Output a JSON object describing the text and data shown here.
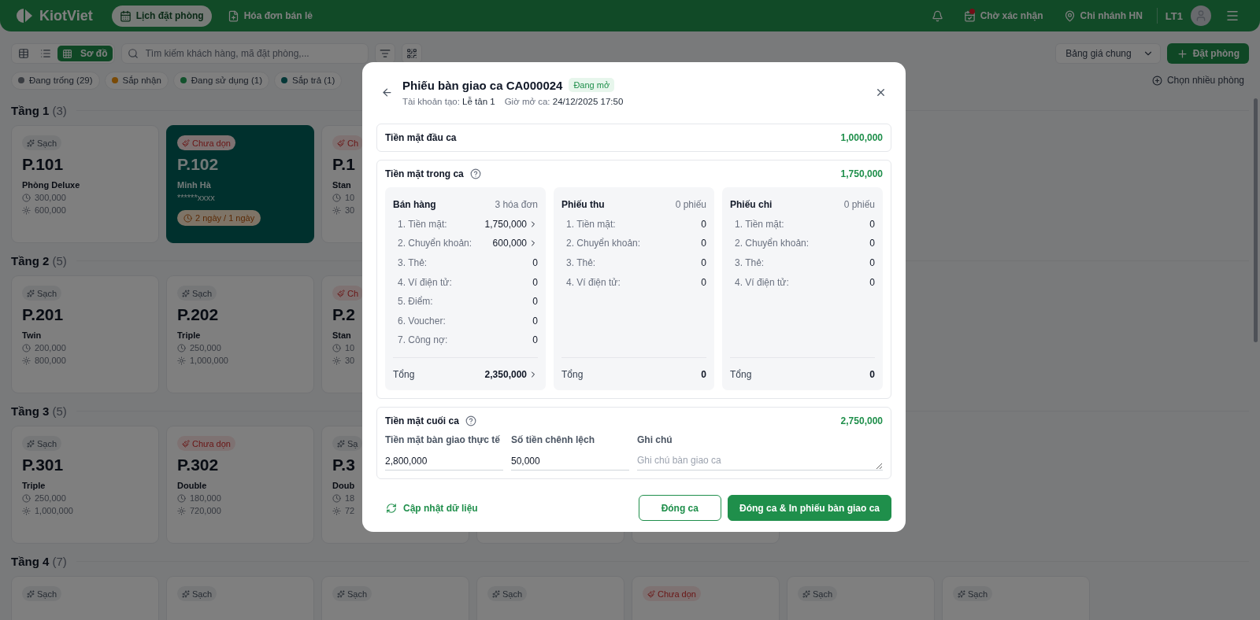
{
  "header": {
    "logo": "KiotViet",
    "tabs": [
      {
        "label": "Lịch đặt phòng",
        "kind": "calendar",
        "selected": true
      },
      {
        "label": "Hóa đơn bán lẻ",
        "kind": "invoice",
        "selected": false
      }
    ],
    "pending": "Chờ xác nhận",
    "pending_alert": true,
    "branch": "Chi nhánh HN",
    "user": "LT1"
  },
  "toolbar": {
    "views": [
      {
        "kind": "table",
        "selected": false
      },
      {
        "kind": "list",
        "selected": false
      },
      {
        "kind": "grid",
        "label": "Sơ đồ",
        "selected": true
      }
    ],
    "search": {
      "placeholder": "Tìm kiếm khách hàng, mã đặt phòng,..."
    },
    "price_list": "Bảng giá chung",
    "book_button": "Đặt phòng"
  },
  "status_filters": [
    {
      "label": "Đang trống (29)",
      "color": "#3a3d42"
    },
    {
      "label": "Sắp nhận",
      "color": "#7a4a06"
    },
    {
      "label": "Đang sử dụng (1)",
      "color": "#13522d"
    },
    {
      "label": "Sắp trả (1)",
      "color": "#053838"
    }
  ],
  "select_multiple": "Chọn nhiều phòng",
  "floors": [
    {
      "name": "Tầng 1",
      "count": "(3)",
      "rooms": [
        {
          "kind": "vacant",
          "status": {
            "kind": "clean",
            "label": "Sạch"
          },
          "name": "P.101",
          "type": "Phòng Deluxe",
          "hourly": "300,000",
          "daily": "600,000"
        },
        {
          "kind": "occupied",
          "status": {
            "kind": "dirty",
            "label": "Chưa dọn"
          },
          "name": "P.102",
          "guest": "Minh Hà",
          "phone": "******xxxx",
          "duration": "2 ngày / 1 ngày"
        },
        {
          "kind": "vacant",
          "status": {
            "kind": "dirty",
            "label": "Ch"
          },
          "name": "P.1",
          "type": "Stan",
          "hourly": "10",
          "daily": "30"
        }
      ]
    },
    {
      "name": "Tầng 2",
      "count": "(5)",
      "rooms": [
        {
          "kind": "vacant",
          "status": {
            "kind": "clean",
            "label": "Sạch"
          },
          "name": "P.201",
          "type": "Twin",
          "hourly": "200,000",
          "daily": "800,000"
        },
        {
          "kind": "vacant",
          "status": {
            "kind": "clean",
            "label": "Sạch"
          },
          "name": "P.202",
          "type": "Triple",
          "hourly": "250,000",
          "daily": "1,000,000"
        },
        {
          "kind": "vacant",
          "status": {
            "kind": "dirty",
            "label": "Ch"
          },
          "name": "P.2",
          "type": "Stan",
          "hourly": "10",
          "daily": "30"
        }
      ]
    },
    {
      "name": "Tầng 3",
      "count": "(5)",
      "rooms": [
        {
          "kind": "vacant",
          "status": {
            "kind": "clean",
            "label": "Sạch"
          },
          "name": "P.301",
          "type": "Triple",
          "hourly": "250,000",
          "daily": "1,000,000"
        },
        {
          "kind": "vacant",
          "status": {
            "kind": "dirty",
            "label": "Chưa dọn"
          },
          "name": "P.302",
          "type": "Double",
          "hourly": "180,000",
          "daily": "720,000"
        },
        {
          "kind": "vacant",
          "status": {
            "kind": "clean",
            "label": "Sạ"
          },
          "name": "P.3",
          "type": "Doub",
          "hourly": "18",
          "daily": "72"
        },
        {
          "kind": "vacant"
        },
        {
          "kind": "vacant"
        }
      ]
    },
    {
      "name": "Tầng 4",
      "count": "(7)",
      "rooms": [
        {
          "kind": "vacant",
          "status": {
            "kind": "clean",
            "label": "Sạch"
          }
        },
        {
          "kind": "vacant",
          "status": {
            "kind": "clean",
            "label": "Sạch"
          }
        },
        {
          "kind": "vacant",
          "status": {
            "kind": "clean",
            "label": "Sạch"
          }
        },
        {
          "kind": "vacant",
          "status": {
            "kind": "clean",
            "label": "Sạch"
          }
        },
        {
          "kind": "vacant",
          "status": {
            "kind": "dirty",
            "label": "Chưa dọn"
          }
        },
        {
          "kind": "vacant",
          "status": {
            "kind": "clean",
            "label": "Sạch"
          }
        },
        {
          "kind": "vacant",
          "status": {
            "kind": "clean",
            "label": "Sạch"
          }
        }
      ]
    }
  ],
  "modal": {
    "title": "Phiếu bàn giao ca CA000024",
    "badge": "Đang mở",
    "meta": [
      {
        "label": "Tài khoản tạo:",
        "value": "Lễ tân 1"
      },
      {
        "label": "Giờ mở ca:",
        "value": "24/12/2025 17:50"
      }
    ],
    "opening": {
      "label": "Tiền mặt đầu ca",
      "amount": "1,000,000"
    },
    "in_shift": {
      "label": "Tiền mặt trong ca",
      "amount": "1,750,000",
      "groups": [
        {
          "title": "Bán hàng",
          "count": "3 hóa đơn",
          "rows": [
            {
              "label": "1. Tiền mặt:",
              "value": "1,750,000",
              "link": true
            },
            {
              "label": "2. Chuyển khoản:",
              "value": "600,000",
              "link": true
            },
            {
              "label": "3. Thẻ:",
              "value": "0",
              "link": false
            },
            {
              "label": "4. Ví điện tử:",
              "value": "0",
              "link": false
            },
            {
              "label": "5. Điểm:",
              "value": "0",
              "link": false
            },
            {
              "label": "6. Voucher:",
              "value": "0",
              "link": false
            },
            {
              "label": "7. Công nợ:",
              "value": "0",
              "link": false
            }
          ],
          "total": {
            "label": "Tổng",
            "value": "2,350,000",
            "link": true
          }
        },
        {
          "title": "Phiếu thu",
          "count": "0 phiếu",
          "rows": [
            {
              "label": "1. Tiền mặt:",
              "value": "0",
              "link": false
            },
            {
              "label": "2. Chuyển khoản:",
              "value": "0",
              "link": false
            },
            {
              "label": "3. Thẻ:",
              "value": "0",
              "link": false
            },
            {
              "label": "4. Ví điện tử:",
              "value": "0",
              "link": false
            }
          ],
          "total": {
            "label": "Tổng",
            "value": "0",
            "link": false
          }
        },
        {
          "title": "Phiếu chi",
          "count": "0 phiếu",
          "rows": [
            {
              "label": "1. Tiền mặt:",
              "value": "0",
              "link": false
            },
            {
              "label": "2. Chuyển khoản:",
              "value": "0",
              "link": false
            },
            {
              "label": "3. Thẻ:",
              "value": "0",
              "link": false
            },
            {
              "label": "4. Ví điện tử:",
              "value": "0",
              "link": false
            }
          ],
          "total": {
            "label": "Tổng",
            "value": "0",
            "link": false
          }
        }
      ]
    },
    "closing": {
      "label": "Tiền mặt cuối ca",
      "amount": "2,750,000",
      "fields": [
        {
          "kind": "input",
          "label": "Tiền mặt bàn giao thực tế",
          "value": "2,800,000"
        },
        {
          "kind": "input",
          "label": "Số tiền chênh lệch",
          "value": "50,000"
        },
        {
          "kind": "textarea",
          "label": "Ghi chú",
          "placeholder": "Ghi chú bàn giao ca"
        }
      ]
    },
    "refresh": "Cập nhật dữ liệu",
    "buttons": [
      {
        "kind": "outline",
        "label": "Đóng ca"
      },
      {
        "kind": "primary",
        "label": "Đóng ca & In phiếu bàn giao ca"
      }
    ]
  }
}
